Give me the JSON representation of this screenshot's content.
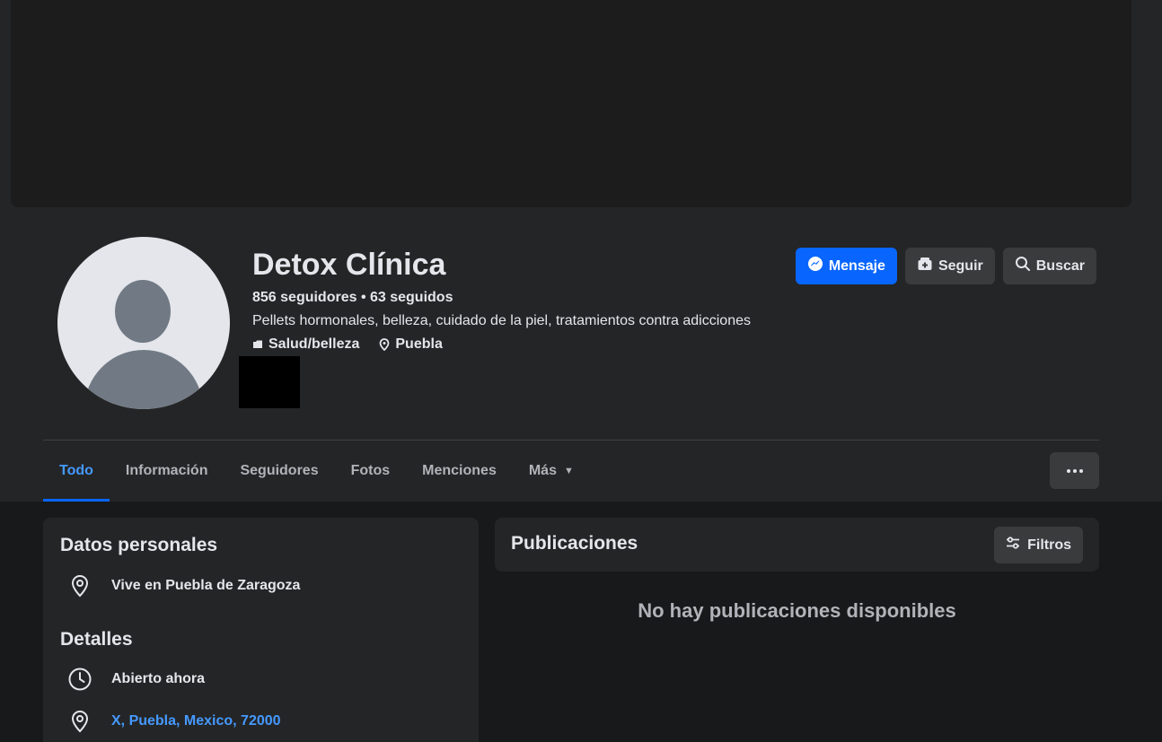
{
  "profile": {
    "name": "Detox Clínica",
    "stats": "856 seguidores • 63 seguidos",
    "bio": "Pellets hormonales, belleza, cuidado de la piel, tratamientos contra adicciones",
    "category": "Salud/belleza",
    "location": "Puebla"
  },
  "actions": {
    "message_label": "Mensaje",
    "follow_label": "Seguir",
    "search_label": "Buscar"
  },
  "tabs": [
    {
      "label": "Todo",
      "active": true
    },
    {
      "label": "Información"
    },
    {
      "label": "Seguidores"
    },
    {
      "label": "Fotos"
    },
    {
      "label": "Menciones"
    },
    {
      "label": "Más"
    }
  ],
  "personal": {
    "title": "Datos personales",
    "lives_in": "Vive en Puebla de Zaragoza"
  },
  "details": {
    "title": "Detalles",
    "hours": "Abierto ahora",
    "address": "X, Puebla, Mexico, 72000"
  },
  "posts": {
    "title": "Publicaciones",
    "filters_label": "Filtros",
    "empty_text": "No hay publicaciones disponibles"
  },
  "colors": {
    "accent": "#0866ff",
    "link": "#4599ff",
    "background": "#18191a",
    "surface": "#242526"
  },
  "icons": [
    "messenger-icon",
    "follow-icon",
    "search-icon",
    "category-icon",
    "location-pin-icon",
    "more-dots-icon",
    "filter-icon",
    "clock-icon",
    "caret-down-icon"
  ]
}
